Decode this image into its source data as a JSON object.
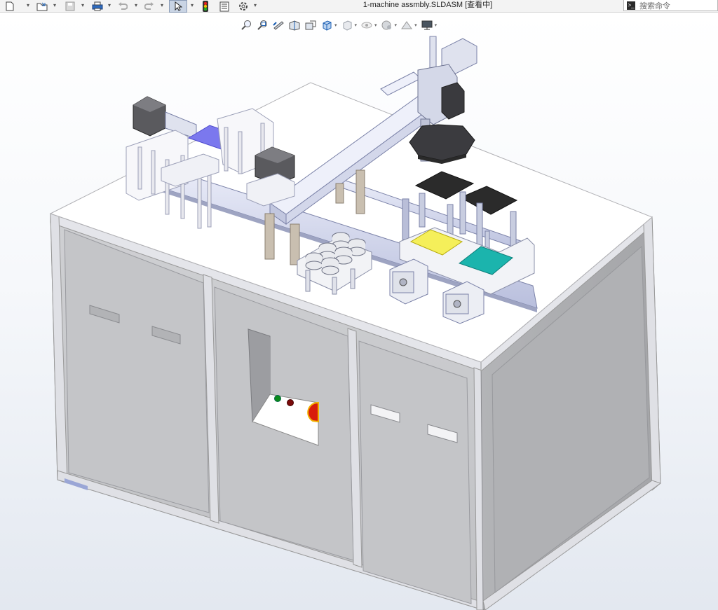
{
  "window": {
    "title": "1-machine assmbly.SLDASM [查看中]"
  },
  "search": {
    "placeholder": "搜索命令"
  },
  "toolbar": {
    "buttons": [
      {
        "name": "new-document",
        "icon": "file-icon"
      },
      {
        "name": "open",
        "icon": "folder-icon"
      },
      {
        "name": "save",
        "icon": "save-icon"
      },
      {
        "name": "print",
        "icon": "print-icon"
      },
      {
        "name": "undo",
        "icon": "undo-icon"
      },
      {
        "name": "redo",
        "icon": "redo-icon"
      },
      {
        "name": "select",
        "icon": "cursor-icon"
      },
      {
        "name": "rebuild",
        "icon": "traffic-light-icon"
      },
      {
        "name": "file-properties",
        "icon": "properties-icon"
      },
      {
        "name": "options",
        "icon": "gear-icon"
      }
    ]
  },
  "heads_up_toolbar": [
    {
      "name": "zoom-to-fit",
      "icon": "zoom-fit-icon"
    },
    {
      "name": "zoom-to-area",
      "icon": "zoom-area-icon"
    },
    {
      "name": "previous-view",
      "icon": "previous-view-icon"
    },
    {
      "name": "section-view",
      "icon": "section-view-icon"
    },
    {
      "name": "dynamic-annotation",
      "icon": "annotation-icon"
    },
    {
      "name": "view-orientation",
      "icon": "cube-icon"
    },
    {
      "name": "display-style",
      "icon": "display-style-icon"
    },
    {
      "name": "hide-show",
      "icon": "eye-icon"
    },
    {
      "name": "edit-appearance",
      "icon": "appearance-icon"
    },
    {
      "name": "apply-scene",
      "icon": "scene-icon"
    },
    {
      "name": "view-settings",
      "icon": "monitor-icon"
    }
  ],
  "colors": {
    "cabinet_front": "#c5c6c9",
    "cabinet_side": "#a9aaad",
    "table_top": "#ffffff",
    "blue_plate": "#7b78ee",
    "yellow_plate": "#f5ef5a",
    "teal_plate": "#1bb4ad",
    "black_plate": "#2b2b2b",
    "emergency_stop": "#d81c0c"
  }
}
